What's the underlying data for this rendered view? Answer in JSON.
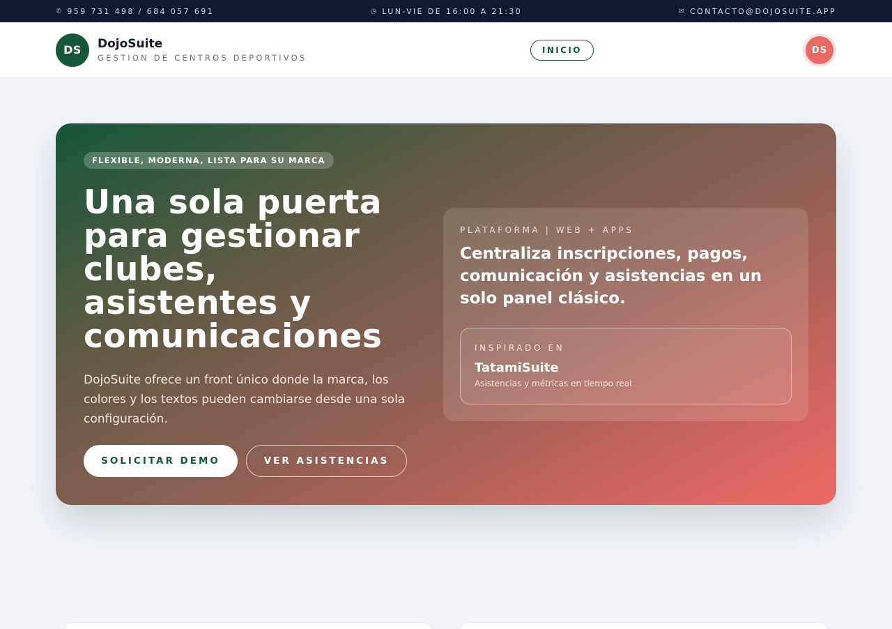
{
  "topbar": {
    "phone_icon": "phone-icon",
    "phone": "959 731 498 / 684 057 691",
    "hours_icon": "clock-icon",
    "hours": "LUN-VIE DE 16:00 A 21:30",
    "email_icon": "mail-icon",
    "email": "CONTACTO@DOJOSUITE.APP"
  },
  "header": {
    "logo_initials": "DS",
    "brand_name": "DojoSuite",
    "brand_sub": "GESTION DE CENTROS DEPORTIVOS",
    "nav_inicio": "INICIO",
    "avatar_initials": "DS"
  },
  "hero": {
    "badge": "FLEXIBLE, MODERNA, LISTA PARA SU MARCA",
    "title": "Una sola puerta para gestionar clubes, asistentes y comunicaciones",
    "description": "DojoSuite ofrece un front único donde la marca, los colores y los textos pueden cambiarse desde una sola configuración.",
    "primary_button": "SOLICITAR DEMO",
    "secondary_button": "VER ASISTENCIAS",
    "panel": {
      "eyebrow": "PLATAFORMA | WEB + APPS",
      "title": "Centraliza inscripciones, pagos, comunicación y asistencias en un solo panel clásico.",
      "card": {
        "eyebrow": "INSPIRADO EN",
        "title": "TatamiSuite",
        "subtitle": "Asistencias y métricas en tiempo real"
      }
    }
  },
  "colors": {
    "brand_green": "#14573a",
    "accent_coral": "#ee6964",
    "topbar_bg": "#0f1a2e",
    "page_bg": "#f2f4fa"
  }
}
